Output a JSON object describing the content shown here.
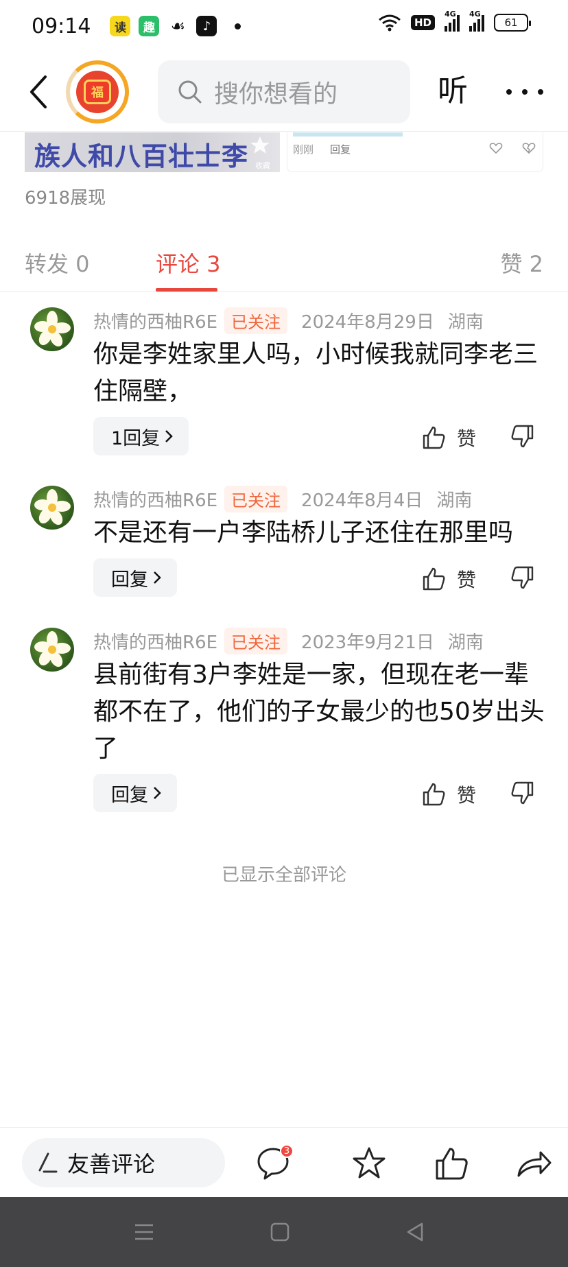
{
  "status_bar": {
    "time": "09:14",
    "apps": [
      "读",
      "趣",
      "wechat-icon",
      "tiktok-icon"
    ],
    "hd": "HD",
    "network1": "4G",
    "network2": "4G",
    "battery": "61"
  },
  "nav": {
    "logo_text": "福",
    "search_placeholder": "搜你想看的",
    "listen_label": "听"
  },
  "article_strip": {
    "title": "族人和八百壮士李",
    "fav_label": "收藏",
    "time": "刚刚",
    "reply": "回复"
  },
  "views": "6918展现",
  "tabs": {
    "forward": "转发 0",
    "comment": "评论 3",
    "like": "赞 2"
  },
  "comments": [
    {
      "name": "热情的西柚R6E",
      "badge": "已关注",
      "date": "2024年8月29日",
      "region": "湖南",
      "text": "你是李姓家里人吗，小时候我就同李老三住隔壁，",
      "reply_label": "1回复",
      "like_label": "赞"
    },
    {
      "name": "热情的西柚R6E",
      "badge": "已关注",
      "date": "2024年8月4日",
      "region": "湖南",
      "text": "不是还有一户李陆桥儿子还住在那里吗",
      "reply_label": "回复",
      "like_label": "赞"
    },
    {
      "name": "热情的西柚R6E",
      "badge": "已关注",
      "date": "2023年9月21日",
      "region": "湖南",
      "text": "县前街有3户李姓是一家，但现在老一辈都不在了，他们的子女最少的也50岁出头了",
      "reply_label": "回复",
      "like_label": "赞"
    }
  ],
  "footer_note": "已显示全部评论",
  "bottom_bar": {
    "comment_placeholder": "友善评论",
    "comment_count": "3"
  },
  "colors": {
    "accent": "#e8473d",
    "follow_bg": "#fff1ec",
    "follow_text": "#f0663c"
  }
}
